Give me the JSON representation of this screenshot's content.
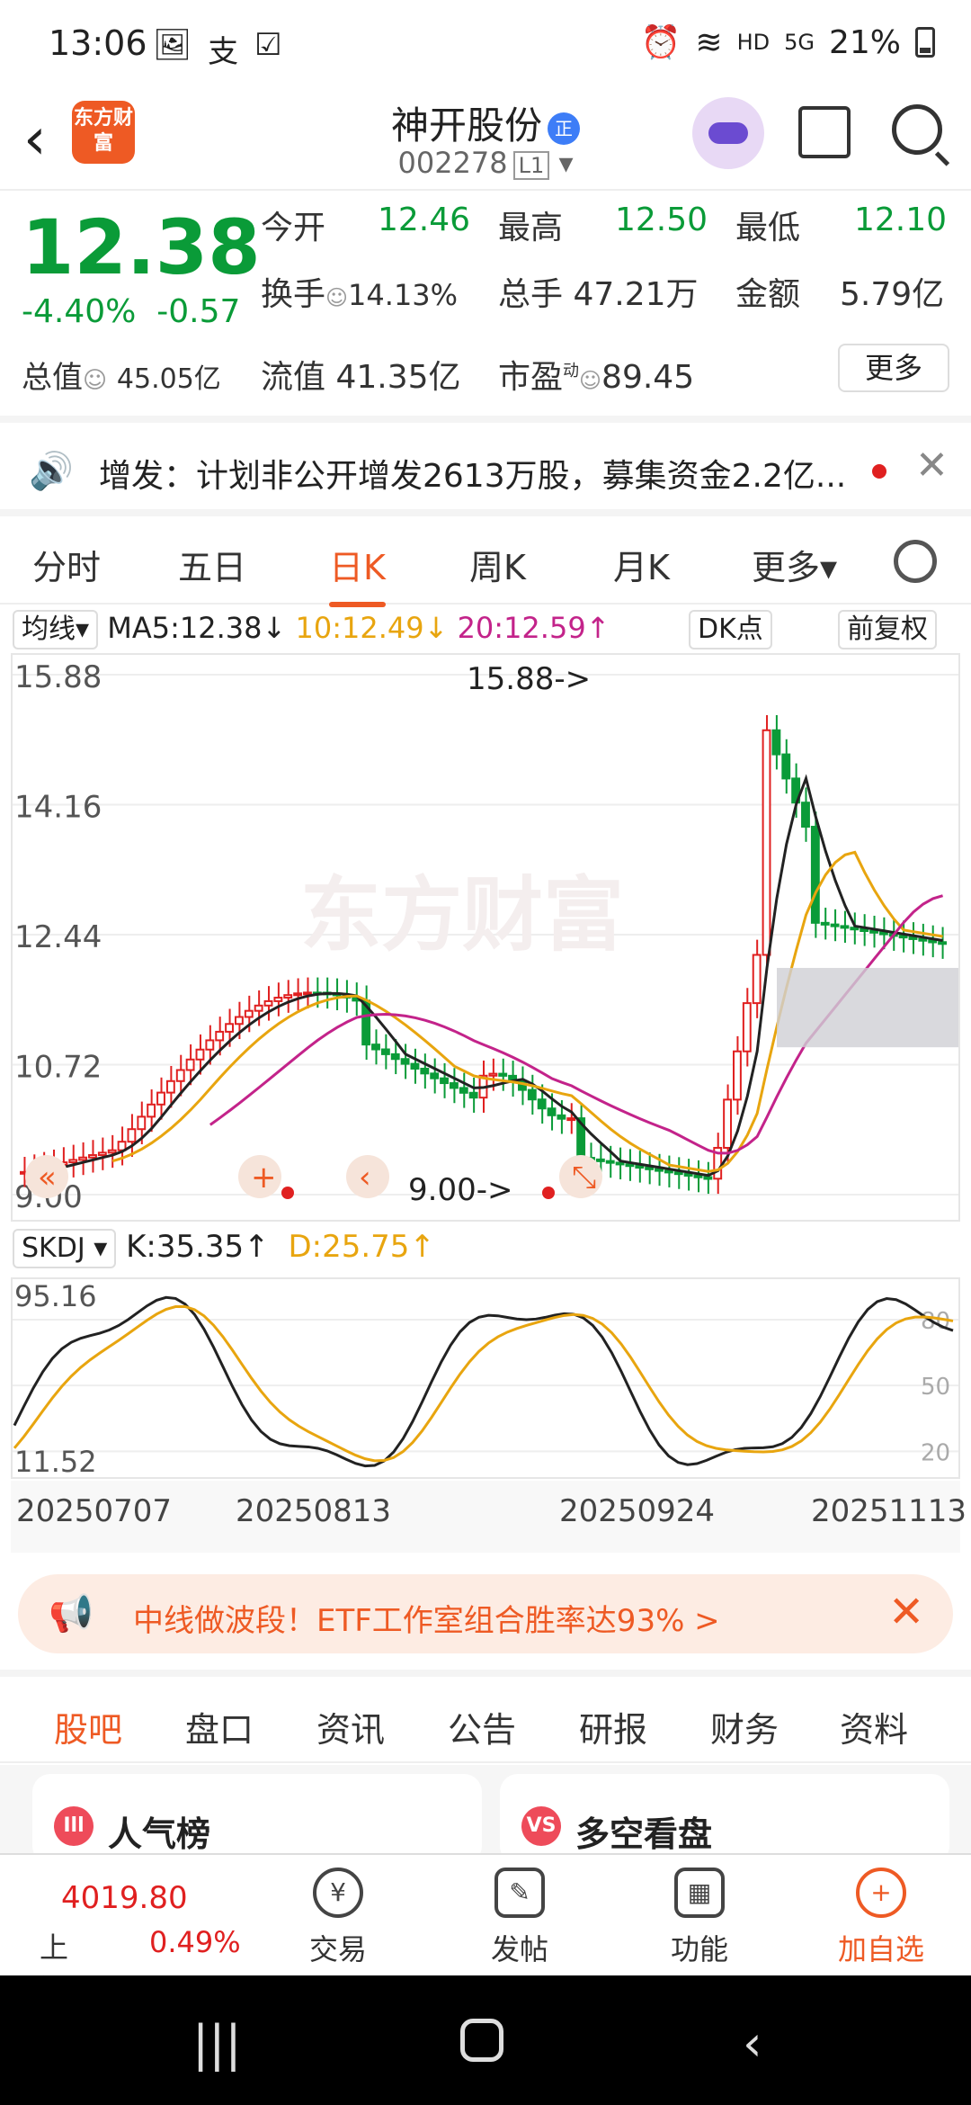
{
  "status": {
    "time": "13:06",
    "battery": "21%",
    "net": "5G",
    "hd": "HD",
    "left_icons": [
      "🖼",
      "支",
      "☑"
    ]
  },
  "header": {
    "logo": "东方财富",
    "title": "神开股份",
    "title_badge": "正",
    "code": "002278",
    "level": "L1"
  },
  "quote": {
    "price": "12.38",
    "pct": "-4.40%",
    "chg": "-0.57",
    "total_label": "总值",
    "total_value": "45.05亿",
    "open_label": "今开",
    "open": "12.46",
    "high_label": "最高",
    "high": "12.50",
    "low_label": "最低",
    "low": "12.10",
    "turnover_label": "换手",
    "turnover": "14.13%",
    "volume_label": "总手",
    "volume": "47.21万",
    "amount_label": "金额",
    "amount": "5.79亿",
    "float_label": "流值",
    "float": "41.35亿",
    "pe_label": "市盈",
    "pe_sup": "动",
    "pe": "89.45",
    "more": "更多"
  },
  "notice": {
    "text": "增发：计划非公开增发2613万股，募集资金2.2亿..."
  },
  "period_tabs": [
    {
      "label": "分时"
    },
    {
      "label": "五日"
    },
    {
      "label": "日K"
    },
    {
      "label": "周K"
    },
    {
      "label": "月K"
    },
    {
      "label": "更多▾"
    }
  ],
  "ma": {
    "sel": "均线▾",
    "ma5": "MA5:12.38↓",
    "ma10": "10:12.49↓",
    "ma20": "20:12.59↑",
    "dk": "DK点",
    "adj": "前复权"
  },
  "chart": {
    "y_ticks": [
      "15.88",
      "14.16",
      "12.44",
      "10.72",
      "9.00"
    ],
    "max_label": "15.88->",
    "min_label": "9.00->",
    "watermark": "东方财富"
  },
  "kdj": {
    "sel": "SKDJ ▾",
    "k": "K:35.35↑",
    "d": "D:25.75↑",
    "y_top": "95.16",
    "y_bottom": "11.52",
    "grid": [
      "80",
      "50",
      "20"
    ]
  },
  "dates": [
    "20250707",
    "20250813",
    "20250924",
    "20251113"
  ],
  "promo": {
    "text": "中线做波段！ETF工作室组合胜率达93% >"
  },
  "sub_tabs": [
    {
      "label": "股吧"
    },
    {
      "label": "盘口"
    },
    {
      "label": "资讯"
    },
    {
      "label": "公告"
    },
    {
      "label": "研报"
    },
    {
      "label": "财务"
    },
    {
      "label": "资料"
    }
  ],
  "cards": [
    {
      "label": "人气榜",
      "icon": "Ill"
    },
    {
      "label": "多空看盘",
      "icon": "VS"
    }
  ],
  "bottom": {
    "index_value": "4019.80",
    "index_name": "上证",
    "index_pct": "0.49%",
    "nav": [
      {
        "label": "交易",
        "icon": "¥"
      },
      {
        "label": "发帖",
        "icon": "✎"
      },
      {
        "label": "功能",
        "icon": "▦"
      },
      {
        "label": "加自选",
        "icon": "+"
      }
    ]
  },
  "chart_data": {
    "type": "candlestick",
    "ylim": [
      9.0,
      15.88
    ],
    "annotations": [
      "15.88->",
      "9.00->"
    ],
    "x_tick_labels": [
      "20250707",
      "20250813",
      "20250924",
      "20251113"
    ],
    "last_close": 12.38,
    "ma": {
      "MA5": 12.38,
      "MA10": 12.49,
      "MA20": 12.59
    },
    "skdj": {
      "K": 35.35,
      "D": 25.75,
      "ylim": [
        11.52,
        95.16
      ]
    }
  }
}
